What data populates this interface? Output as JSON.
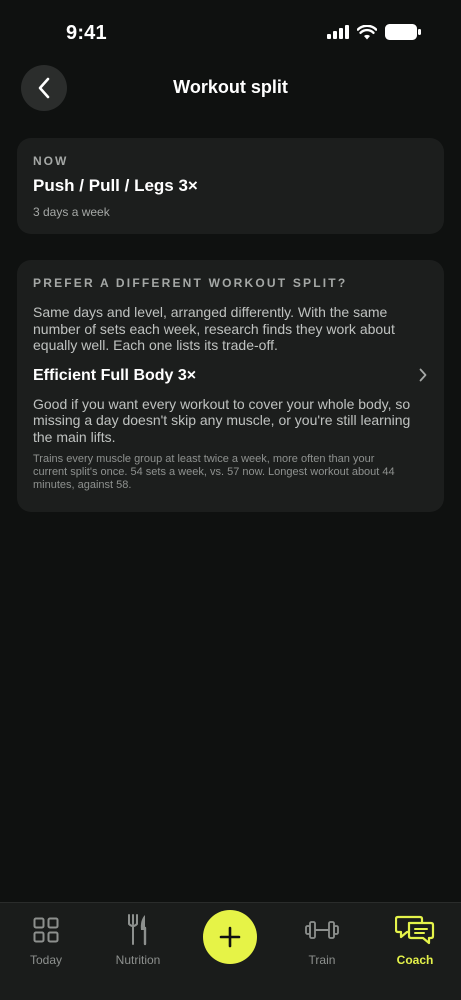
{
  "status_bar": {
    "time": "9:41"
  },
  "header": {
    "title": "Workout split",
    "back_icon": "chevron-left-icon"
  },
  "current_split": {
    "eyebrow": "NOW",
    "name": "Push / Pull / Legs 3×",
    "frequency": "3 days a week"
  },
  "alternative": {
    "eyebrow": "PREFER A DIFFERENT WORKOUT SPLIT?",
    "intro": "Same days and level, arranged differently. With the same number of sets each week, research finds they work about equally well. Each one lists its trade-off.",
    "option": {
      "title": "Efficient Full Body 3×",
      "description": "Good if you want every workout to cover your whole body, so missing a day doesn't skip any muscle, or you're still learning the main lifts.",
      "note": "Trains every muscle group at least twice a week, more often than your current split's once. 54 sets a week, vs. 57 now. Longest workout about 44 minutes, against 58."
    }
  },
  "tab_bar": {
    "tabs": [
      {
        "label": "Today",
        "icon": "grid-icon"
      },
      {
        "label": "Nutrition",
        "icon": "fork-knife-icon"
      },
      {
        "label": "Train",
        "icon": "dumbbell-icon"
      },
      {
        "label": "Coach",
        "icon": "chat-bubbles-icon"
      }
    ],
    "add_icon": "plus-icon"
  },
  "colors": {
    "background": "#0f1110",
    "card": "#1c1e1d",
    "accent": "#e6f347",
    "muted_text": "#a5a8a6"
  }
}
